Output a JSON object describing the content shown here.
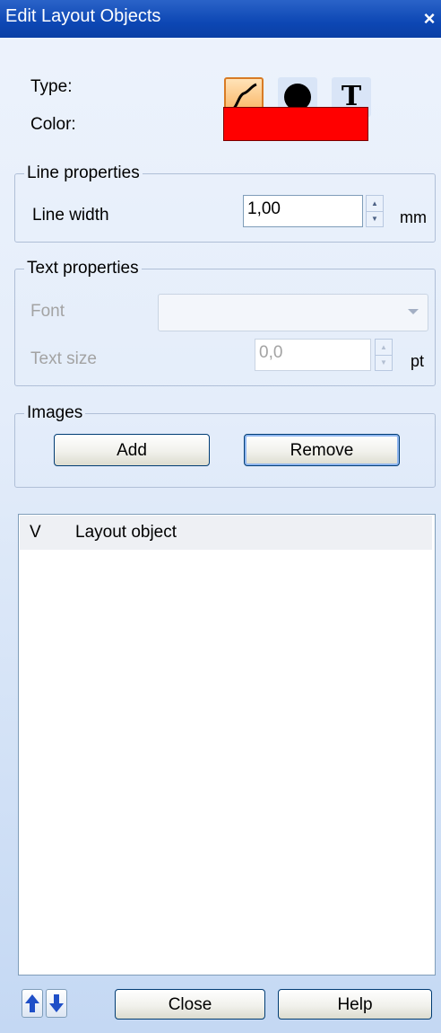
{
  "window": {
    "title": "Edit Layout Objects",
    "close_glyph": "×"
  },
  "type_row": {
    "label": "Type:",
    "buttons": [
      {
        "name": "line-tool",
        "icon": "line-curve-icon",
        "selected": true
      },
      {
        "name": "filled-shape-tool",
        "icon": "filled-circle-icon",
        "selected": false
      },
      {
        "name": "text-tool",
        "icon": "text-icon",
        "glyph": "T",
        "selected": false
      }
    ]
  },
  "color_row": {
    "label": "Color:",
    "value": "#ff0000"
  },
  "line_properties": {
    "legend": "Line properties",
    "line_width_label": "Line width",
    "line_width_value": "1,00",
    "unit": "mm"
  },
  "text_properties": {
    "legend": "Text properties",
    "font_label": "Font",
    "font_value": "",
    "text_size_label": "Text size",
    "text_size_value": "0,0",
    "unit": "pt"
  },
  "images": {
    "legend": "Images",
    "add_label": "Add",
    "remove_label": "Remove"
  },
  "layout_list": {
    "columns": [
      "V",
      "Layout object"
    ],
    "rows": []
  },
  "footer": {
    "move_up_icon": "arrow-up-icon",
    "move_down_icon": "arrow-down-icon",
    "close_label": "Close",
    "help_label": "Help"
  },
  "colors": {
    "titlebar": "#0d47b4",
    "selected_tool": "#f9b15c",
    "swatch": "#ff0000",
    "arrow_icons": "#1f4fc7"
  }
}
